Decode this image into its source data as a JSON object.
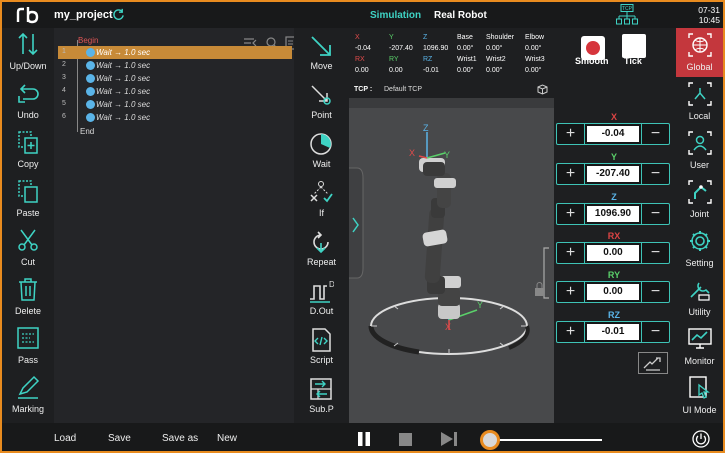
{
  "header": {
    "logo": "rb",
    "project_name": "my_project",
    "sync_icon": "refresh-icon",
    "mode_simulation": "Simulation",
    "mode_real": "Real Robot",
    "tcp_icon_label": "TCP",
    "date": "07-31",
    "time": "10:45"
  },
  "left_tools": [
    {
      "label": "Up/Down",
      "icon": "updown-icon"
    },
    {
      "label": "Undo",
      "icon": "undo-icon"
    },
    {
      "label": "Copy",
      "icon": "copy-icon"
    },
    {
      "label": "Paste",
      "icon": "paste-icon"
    },
    {
      "label": "Cut",
      "icon": "cut-icon"
    },
    {
      "label": "Delete",
      "icon": "delete-icon"
    },
    {
      "label": "Pass",
      "icon": "pass-icon"
    },
    {
      "label": "Marking",
      "icon": "marking-icon"
    }
  ],
  "program": {
    "begin_label": "Begin",
    "end_label": "End",
    "rows": [
      {
        "num": "1",
        "text": "Wait → 1.0 sec",
        "selected": true
      },
      {
        "num": "2",
        "text": "Wait → 1.0 sec",
        "selected": false
      },
      {
        "num": "3",
        "text": "Wait → 1.0 sec",
        "selected": false
      },
      {
        "num": "4",
        "text": "Wait → 1.0 sec",
        "selected": false
      },
      {
        "num": "5",
        "text": "Wait → 1.0 sec",
        "selected": false
      },
      {
        "num": "6",
        "text": "Wait → 1.0 sec",
        "selected": false
      }
    ]
  },
  "command_tools": [
    {
      "label": "Move",
      "icon": "move-icon"
    },
    {
      "label": "Point",
      "icon": "point-icon"
    },
    {
      "label": "Wait",
      "icon": "wait-icon"
    },
    {
      "label": "If",
      "icon": "if-icon"
    },
    {
      "label": "Repeat",
      "icon": "repeat-icon"
    },
    {
      "label": "D.Out",
      "icon": "dout-icon"
    },
    {
      "label": "Script",
      "icon": "script-icon"
    },
    {
      "label": "Sub.P",
      "icon": "subp-icon"
    }
  ],
  "pose_info": {
    "X": "-0.04",
    "Y": "-207.40",
    "Z": "1096.90",
    "RX": "0.00",
    "RY": "0.00",
    "RZ": "-0.01",
    "Base": "0.00°",
    "Shoulder": "0.00°",
    "Elbow": "0.00°",
    "Wrist1": "0.00°",
    "Wrist2": "0.00°",
    "Wrist3": "0.00°"
  },
  "smooth_label": "Smooth",
  "tick_label": "Tick",
  "tcp": {
    "label": "TCP :",
    "value": "Default TCP"
  },
  "coords": [
    {
      "axis": "X",
      "value": "-0.04"
    },
    {
      "axis": "Y",
      "value": "-207.40"
    },
    {
      "axis": "Z",
      "value": "1096.90"
    },
    {
      "axis": "RX",
      "value": "0.00"
    },
    {
      "axis": "RY",
      "value": "0.00"
    },
    {
      "axis": "RZ",
      "value": "-0.01"
    }
  ],
  "stepper": {
    "plus": "+",
    "minus": "−"
  },
  "right_tools": [
    {
      "label": "Global",
      "icon": "globe-icon",
      "active": true
    },
    {
      "label": "Local",
      "icon": "local-icon",
      "active": false
    },
    {
      "label": "User",
      "icon": "user-icon",
      "active": false
    },
    {
      "label": "Joint",
      "icon": "joint-icon",
      "active": false
    },
    {
      "label": "Setting",
      "icon": "gear-icon",
      "active": false
    },
    {
      "label": "Utility",
      "icon": "utility-icon",
      "active": false
    },
    {
      "label": "Monitor",
      "icon": "monitor-icon",
      "active": false
    },
    {
      "label": "UI Mode",
      "icon": "uimode-icon",
      "active": false
    }
  ],
  "bottom": {
    "load": "Load",
    "save": "Save",
    "save_as": "Save as",
    "new": "New",
    "speed_fraction": 0.0
  },
  "colors": {
    "accent": "#3ed3c4",
    "active": "#c4373d",
    "selection": "#c78a38",
    "frame": "#e88b1f"
  }
}
